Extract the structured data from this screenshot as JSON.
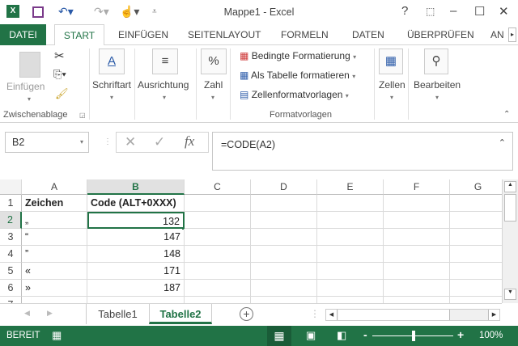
{
  "window": {
    "title": "Mappe1 - Excel"
  },
  "quick_access": {
    "excel_icon": "excel-logo",
    "save_icon": "save-icon",
    "undo_icon": "undo-icon",
    "redo_icon": "redo-icon",
    "touch_icon": "touch-mode-icon",
    "customize_icon": "customize-icon"
  },
  "window_controls": {
    "help": "?",
    "ribbon_options": "⬚",
    "minimize": "–",
    "maximize": "☐",
    "close": "✕"
  },
  "tabs": [
    "DATEI",
    "START",
    "EINFÜGEN",
    "SEITENLAYOUT",
    "FORMELN",
    "DATEN",
    "ÜBERPRÜFEN",
    "AN"
  ],
  "ribbon": {
    "paste": "Einfügen",
    "clipboard_group": "Zwischenablage",
    "font": "Schriftart",
    "alignment": "Ausrichtung",
    "number": "Zahl",
    "conditional": "Bedingte Formatierung",
    "as_table": "Als Tabelle formatieren",
    "cell_styles": "Zellenformatvorlagen",
    "styles_group": "Formatvorlagen",
    "cells": "Zellen",
    "editing": "Bearbeiten"
  },
  "formula_bar": {
    "name_box": "B2",
    "formula": "=CODE(A2)",
    "fx": "fx"
  },
  "sheet": {
    "columns": [
      "A",
      "B",
      "C",
      "D",
      "E",
      "F",
      "G"
    ],
    "selected_cell": "B2",
    "rows": [
      {
        "n": "1",
        "a": "Zeichen",
        "b": "Code (ALT+0XXX)"
      },
      {
        "n": "2",
        "a": "„",
        "b": "132"
      },
      {
        "n": "3",
        "a": "“",
        "b": "147"
      },
      {
        "n": "4",
        "a": "”",
        "b": "148"
      },
      {
        "n": "5",
        "a": "«",
        "b": "171"
      },
      {
        "n": "6",
        "a": "»",
        "b": "187"
      },
      {
        "n": "7",
        "a": "",
        "b": ""
      }
    ]
  },
  "sheet_tabs": [
    "Tabelle1",
    "Tabelle2"
  ],
  "active_sheet": "Tabelle2",
  "status": {
    "ready": "BEREIT",
    "zoom": "100%",
    "zoom_level_percent": 100
  },
  "colors": {
    "accent": "#217346"
  }
}
